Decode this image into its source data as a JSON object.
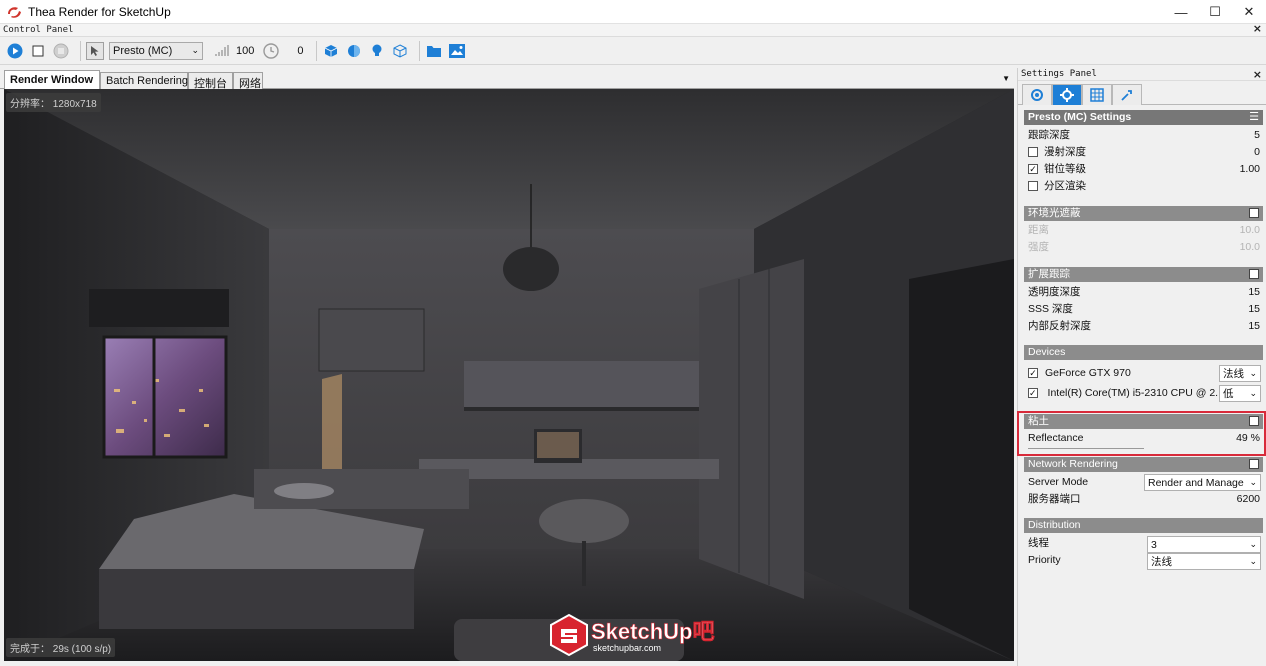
{
  "window": {
    "title": "Thea Render for SketchUp",
    "minimize": "—",
    "maximize": "☐",
    "close": "✕"
  },
  "control_panel": {
    "title": "Control Panel",
    "close": "×",
    "toolbar": {
      "mode_select": "Presto (MC)",
      "spp_value": "100",
      "time_value": "0"
    }
  },
  "tabs": [
    {
      "label": "Render Window",
      "active": true
    },
    {
      "label": "Batch Rendering",
      "active": false
    },
    {
      "label": "控制台",
      "active": false
    },
    {
      "label": "网络",
      "active": false
    }
  ],
  "viewport": {
    "resolution_label": "分辨率： 1280x718",
    "status_label": "完成于： 29s (100 s/p)"
  },
  "settings_panel": {
    "title": "Settings Panel",
    "close": "×",
    "presto": {
      "header": "Presto (MC) Settings",
      "menu": "☰",
      "trace_depth_label": "跟踪深度",
      "trace_depth_value": "5",
      "diffuse_label": "漫射深度",
      "diffuse_value": "0",
      "diffuse_checked": false,
      "clamp_label": "钳位等级",
      "clamp_value": "1.00",
      "clamp_checked": true,
      "region_label": "分区渲染",
      "region_checked": false
    },
    "ao": {
      "header": "环境光遮蔽",
      "checked": false,
      "distance_label": "距离",
      "distance_value": "10.0",
      "intensity_label": "强度",
      "intensity_value": "10.0"
    },
    "extended": {
      "header": "扩展跟踪",
      "checked": true,
      "transparency_label": "透明度深度",
      "transparency_value": "15",
      "sss_label": "SSS 深度",
      "sss_value": "15",
      "internal_label": "内部反射深度",
      "internal_value": "15"
    },
    "devices": {
      "header": "Devices",
      "gpu_label": "GeForce GTX 970",
      "gpu_checked": true,
      "gpu_priority": "法线",
      "cpu_label": "Intel(R) Core(TM) i5-2310 CPU @ 2....",
      "cpu_checked": true,
      "cpu_priority": "低"
    },
    "clay": {
      "header": "粘土",
      "checked": true,
      "reflectance_label": "Reflectance",
      "reflectance_value": "49 %",
      "reflectance_fraction": 0.49
    },
    "network": {
      "header": "Network Rendering",
      "checked": false,
      "server_mode_label": "Server Mode",
      "server_mode_value": "Render and Manage",
      "port_label": "服务器端口",
      "port_value": "6200"
    },
    "distribution": {
      "header": "Distribution",
      "threads_label": "线程",
      "threads_value": "3",
      "priority_label": "Priority",
      "priority_value": "法线"
    }
  },
  "watermark": {
    "logo_text": "SketchUp吧",
    "url": "sketchupbar.com"
  },
  "colors": {
    "accent": "#1e7fd6",
    "highlight": "#d82a3a",
    "section": "#8c8c8c"
  }
}
